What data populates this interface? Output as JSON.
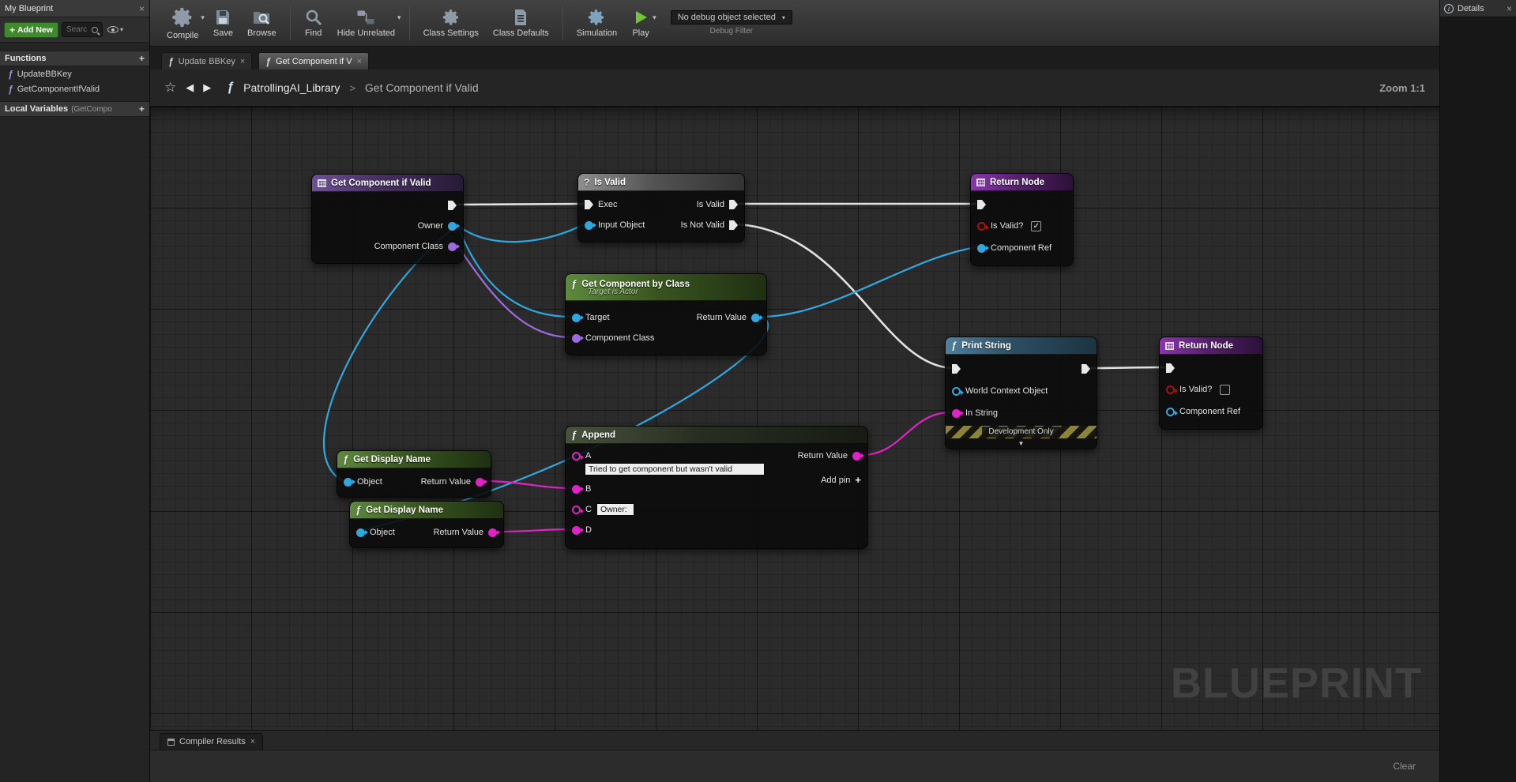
{
  "icons": {
    "close": "×",
    "function": "ƒ",
    "question": "?",
    "dropdown": "▾",
    "collapse_arrow": "▼",
    "plus": "+",
    "star": "☆",
    "back_arrow": "◀",
    "forward_arrow": "▶",
    "check": "✓",
    "breadcrumb_separator": ">",
    "info": "i"
  },
  "my_blueprint": {
    "title": "My Blueprint",
    "add_new": "Add New",
    "search_placeholder": "Searc",
    "functions_header": "Functions",
    "functions": [
      "UpdateBBKey",
      "GetComponentIfValid"
    ],
    "local_variables_header": "Local Variables",
    "local_variables_scope": "(GetCompo"
  },
  "toolbar": {
    "compile": "Compile",
    "save": "Save",
    "browse": "Browse",
    "find": "Find",
    "hide_unrelated": "Hide Unrelated",
    "class_settings": "Class Settings",
    "class_defaults": "Class Defaults",
    "simulation": "Simulation",
    "play": "Play",
    "debug_object": "No debug object selected",
    "debug_filter": "Debug Filter"
  },
  "details": {
    "title": "Details"
  },
  "tabs": {
    "tab1": "Update BBKey",
    "tab2": "Get Component if V"
  },
  "breadcrumb": {
    "library": "PatrollingAI_Library",
    "page": "Get Component if Valid",
    "zoom": "Zoom 1:1"
  },
  "graph": {
    "watermark": "BLUEPRINT",
    "nodes": {
      "entry": {
        "title": "Get Component if Valid",
        "owner": "Owner",
        "component_class": "Component Class"
      },
      "is_valid": {
        "title": "Is Valid",
        "exec": "Exec",
        "input_object": "Input Object",
        "is_valid_out": "Is Valid",
        "is_not_valid_out": "Is Not Valid"
      },
      "return_top": {
        "title": "Return Node",
        "is_valid": "Is Valid?",
        "is_valid_checked": true,
        "component_ref": "Component Ref"
      },
      "get_component_by_class": {
        "title": "Get Component by Class",
        "subtitle": "Target is Actor",
        "target": "Target",
        "component_class": "Component Class",
        "return_value": "Return Value"
      },
      "print_string": {
        "title": "Print String",
        "world_context_object": "World Context Object",
        "in_string": "In String",
        "development_only": "Development Only"
      },
      "return_bottom": {
        "title": "Return Node",
        "is_valid": "Is Valid?",
        "is_valid_checked": false,
        "component_ref": "Component Ref"
      },
      "get_display_name_1": {
        "title": "Get Display Name",
        "object": "Object",
        "return_value": "Return Value"
      },
      "get_display_name_2": {
        "title": "Get Display Name",
        "object": "Object",
        "return_value": "Return Value"
      },
      "append": {
        "title": "Append",
        "pin_a": "A",
        "pin_b": "B",
        "pin_c": "C",
        "pin_d": "D",
        "a_value": "Tried to get component but wasn't valid",
        "c_value": "Owner:",
        "return_value": "Return Value",
        "add_pin": "Add pin"
      }
    }
  },
  "bottom": {
    "compiler_results": "Compiler Results",
    "clear": "Clear"
  },
  "colors": {
    "exec_wire": "#e2e2e2",
    "object_pin": "#2fa8e0",
    "class_pin": "#9a6ce0",
    "string_pin": "#e222c8",
    "bool_pin": "#b00d10",
    "play_green": "#71c837",
    "add_new_green": "#3f8a2c"
  }
}
